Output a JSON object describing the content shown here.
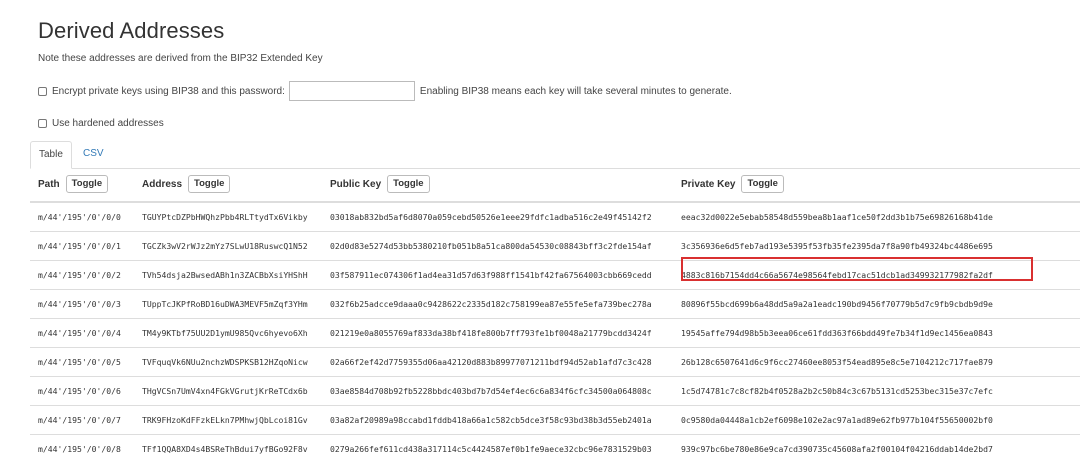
{
  "title": "Derived Addresses",
  "note": "Note these addresses are derived from the BIP32 Extended Key",
  "encrypt": {
    "label": "Encrypt private keys using BIP38 and this password:",
    "password_value": "",
    "hint": "Enabling BIP38 means each key will take several minutes to generate."
  },
  "hardened": {
    "label": "Use hardened addresses"
  },
  "tabs": [
    {
      "label": "Table",
      "active": true
    },
    {
      "label": "CSV",
      "active": false
    }
  ],
  "table": {
    "headers": {
      "path": "Path",
      "address": "Address",
      "public_key": "Public Key",
      "private_key": "Private Key",
      "toggle": "Toggle"
    },
    "rows": [
      {
        "path": "m/44'/195'/0'/0/0",
        "address": "TGUYPtcDZPbHWQhzPbb4RLTtydTx6Vikby",
        "public_key": "03018ab832bd5af6d8070a059cebd50526e1eee29fdfc1adba516c2e49f45142f2",
        "private_key": "eeac32d0022e5ebab58548d559bea8b1aaf1ce50f2dd3b1b75e69826168b41de"
      },
      {
        "path": "m/44'/195'/0'/0/1",
        "address": "TGCZk3wV2rWJz2mYz7SLwU18RuswcQ1N52",
        "public_key": "02d0d83e5274d53bb5380210fb051b8a51ca800da54530c08843bff3c2fde154af",
        "private_key": "3c356936e6d5feb7ad193e5395f53fb35fe2395da7f8a90fb49324bc4486e695"
      },
      {
        "path": "m/44'/195'/0'/0/2",
        "address": "TVh54dsja2BwsedABh1n3ZACBbXsiYHShH",
        "public_key": "03f587911ec074306f1ad4ea31d57d63f988ff1541bf42fa67564003cbb669cedd",
        "private_key": "4883c816b7154dd4c66a5674e98564febd17cac51dcb1ad349932177982fa2df"
      },
      {
        "path": "m/44'/195'/0'/0/3",
        "address": "TUppTcJKPfRoBD16uDWA3MEVF5mZqf3YHm",
        "public_key": "032f6b25adcce9daaa0c9428622c2335d182c758199ea87e55fe5efa739bec278a",
        "private_key": "80896f55bcd699b6a48dd5a9a2a1eadc190bd9456f70779b5d7c9fb9cbdb9d9e"
      },
      {
        "path": "m/44'/195'/0'/0/4",
        "address": "TM4y9KTbf75UU2D1ymU985Qvc6hyevo6Xh",
        "public_key": "021219e0a8055769af833da38bf418fe800b7ff793fe1bf0048a21779bcdd3424f",
        "private_key": "19545affe794d98b5b3eea06ce61fdd363f66bdd49fe7b34f1d9ec1456ea0843"
      },
      {
        "path": "m/44'/195'/0'/0/5",
        "address": "TVFquqVk6NUu2nchzWDSPKSB12HZqoNicw",
        "public_key": "02a66f2ef42d7759355d06aa42120d883b89977071211bdf94d52ab1afd7c3c428",
        "private_key": "26b128c6507641d6c9f6cc27460ee8053f54ead895e8c5e7104212c717fae879"
      },
      {
        "path": "m/44'/195'/0'/0/6",
        "address": "THgVCSn7UmV4xn4FGkVGrutjKrReTCdx6b",
        "public_key": "03ae8584d708b92fb5228bbdc403bd7b7d54ef4ec6c6a834f6cfc34500a064808c",
        "private_key": "1c5d74781c7c8cf82b4f0528a2b2c50b84c3c67b5131cd5253bec315e37c7efc"
      },
      {
        "path": "m/44'/195'/0'/0/7",
        "address": "TRK9FHzoKdFFzkELkn7PMhwjQbLcoi81Gv",
        "public_key": "03a82af20989a98ccabd1fddb418a66a1c582cb5dce3f58c93bd38b3d55eb2401a",
        "private_key": "0c9580da04448a1cb2ef6098e102e2ac97a1ad89e62fb977b104f55650002bf0"
      },
      {
        "path": "m/44'/195'/0'/0/8",
        "address": "TFf1QQA8XD4s4BSReThBdui7yfBGo92F8v",
        "public_key": "0279a266fef611cd438a317114c5c4424587ef0b1fe9aece32cbc96e7831529b03",
        "private_key": "939c97bc6be780e86e9ca7cd390735c45608afa2f00104f04216ddab14de2bd7"
      }
    ]
  }
}
